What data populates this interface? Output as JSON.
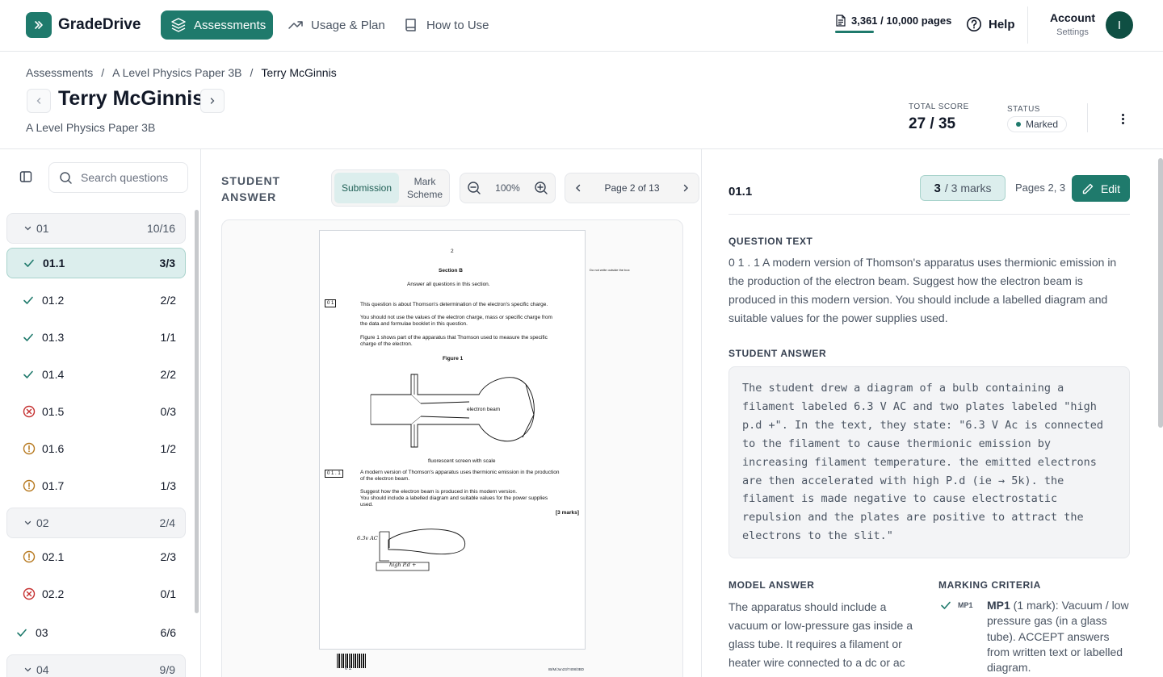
{
  "app": {
    "name": "GradeDrive"
  },
  "nav": {
    "items": [
      {
        "label": "Assessments",
        "active": true
      },
      {
        "label": "Usage & Plan",
        "active": false
      },
      {
        "label": "How to Use",
        "active": false
      }
    ],
    "usage": "3,361 / 10,000 pages",
    "help": "Help",
    "account": "Account",
    "account_sub": "Settings",
    "avatar": "I"
  },
  "breadcrumb": [
    "Assessments",
    "/",
    "A Level Physics Paper 3B",
    "/",
    "Terry McGinnis"
  ],
  "header": {
    "title": "Terry McGinnis",
    "subtitle": "A Level Physics Paper 3B",
    "score_label": "TOTAL SCORE",
    "score": "27 / 35",
    "status_label": "STATUS",
    "status": "Marked"
  },
  "sidebar": {
    "search_placeholder": "Search questions",
    "rows": [
      {
        "kind": "group",
        "label": "01",
        "score": "10/16"
      },
      {
        "kind": "q",
        "label": "01.1",
        "score": "3/3",
        "state": "correct",
        "selected": true
      },
      {
        "kind": "q",
        "label": "01.2",
        "score": "2/2",
        "state": "correct"
      },
      {
        "kind": "q",
        "label": "01.3",
        "score": "1/1",
        "state": "correct"
      },
      {
        "kind": "q",
        "label": "01.4",
        "score": "2/2",
        "state": "correct"
      },
      {
        "kind": "q",
        "label": "01.5",
        "score": "0/3",
        "state": "wrong"
      },
      {
        "kind": "q",
        "label": "01.6",
        "score": "1/2",
        "state": "partial"
      },
      {
        "kind": "q",
        "label": "01.7",
        "score": "1/3",
        "state": "partial"
      },
      {
        "kind": "group",
        "label": "02",
        "score": "2/4"
      },
      {
        "kind": "q",
        "label": "02.1",
        "score": "2/3",
        "state": "partial"
      },
      {
        "kind": "q",
        "label": "02.2",
        "score": "0/1",
        "state": "wrong"
      },
      {
        "kind": "top",
        "label": "03",
        "score": "6/6",
        "state": "correct"
      },
      {
        "kind": "group",
        "label": "04",
        "score": "9/9"
      }
    ]
  },
  "viewer": {
    "title_line1": "STUDENT",
    "title_line2": "ANSWER",
    "seg_on": "Submission",
    "seg_off_1": "Mark",
    "seg_off_2": "Scheme",
    "zoom": "100%",
    "page": "Page 2 of 13",
    "paper": {
      "page_no": "2",
      "section": "Section B",
      "instr": "Answer all questions in this section.",
      "q_num": "0 1",
      "q_intro": "This question is about Thomson's determination of the electron's specific charge.",
      "q_note1": "You should not use the values of the electron charge, mass or specific charge from",
      "q_note2": "the data and formulae booklet in this question.",
      "fig_note1": "Figure 1 shows part of the apparatus that Thomson used to measure the specific",
      "fig_note2": "charge of the electron.",
      "fig_title": "Figure 1",
      "beam": "electron beam",
      "screen": "fluorescent screen with scale",
      "sub_num": "0 1 . 1",
      "sub_q1": "A modern version of Thomson's apparatus uses thermionic emission in the production",
      "sub_q2": "of the electron beam.",
      "sub_q3": "Suggest how the electron beam is produced in this modern version.",
      "sub_q4": "You should include a labelled diagram and suitable values for the power supplies",
      "sub_q5": "used.",
      "marks": "[3 marks]",
      "hw1": "6.3v AC",
      "hw2": "high P.d +",
      "barcode_no": "0 2",
      "footer_code": "IB/M/Jun23/7408/3BD",
      "margin_note": "Do not write outside the box"
    }
  },
  "detail": {
    "qnum": "01.1",
    "marks_awarded": "3",
    "marks_total": "/ 3 marks",
    "pages": "Pages 2, 3",
    "edit": "Edit",
    "question_heading": "QUESTION TEXT",
    "question_text": "0 1 . 1 A modern version of Thomson's apparatus uses thermionic emission in the production of the electron beam. Suggest how the electron beam is produced in this modern version. You should include a labelled diagram and suitable values for the power supplies used.",
    "answer_heading": "STUDENT ANSWER",
    "answer_text": "The student drew a diagram of a bulb containing a filament labeled 6.3 V AC and two plates labeled \"high p.d +\". In the text, they state: \"6.3 V Ac is connected to the filament to cause thermionic emission by increasing filament temperature. the emitted electrons are then accelerated with high P.d (ie → 5k). the filament is made negative to cause electrostatic repulsion and the plates are positive to attract the electrons to the slit.\"",
    "model_heading": "MODEL ANSWER",
    "model_text": "The apparatus should include a vacuum or low-pressure gas inside a glass tube. It requires a filament or heater wire connected to a dc or ac",
    "criteria_heading": "MARKING CRITERIA",
    "criteria": [
      {
        "code": "MP1",
        "title": "MP1",
        "text": " (1 mark): Vacuum / low pressure gas (in a glass tube). ACCEPT answers from written text or labelled diagram."
      }
    ]
  },
  "colors": {
    "accent": "#1f7a6c",
    "selected_bg": "#dceeed",
    "wrong": "#c53030",
    "partial": "#b7791f"
  }
}
